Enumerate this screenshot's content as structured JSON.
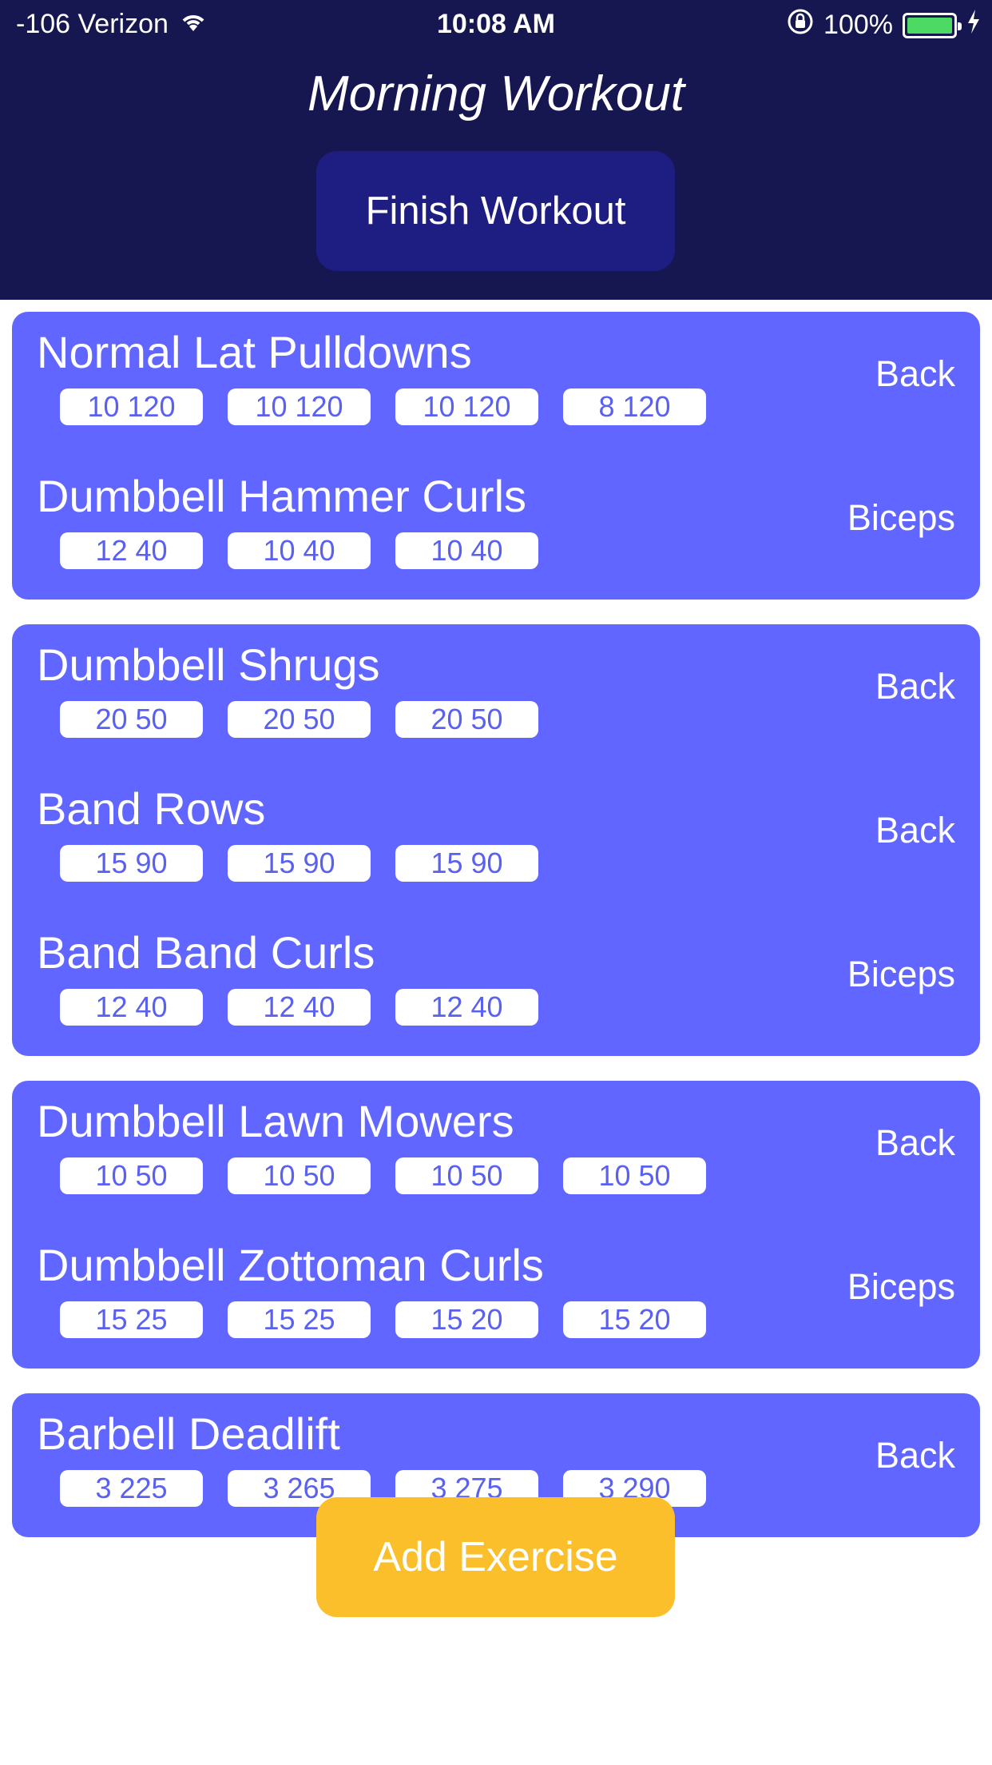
{
  "status_bar": {
    "carrier": "-106 Verizon",
    "time": "10:08 AM",
    "battery": "100%",
    "battery_level": 1.0
  },
  "header": {
    "title": "Morning Workout",
    "finish_label": "Finish Workout"
  },
  "groups": [
    {
      "exercises": [
        {
          "name": "Normal Lat Pulldowns",
          "muscle": "Back",
          "sets": [
            "10 120",
            "10 120",
            "10 120",
            "8 120"
          ]
        },
        {
          "name": "Dumbbell Hammer Curls",
          "muscle": "Biceps",
          "sets": [
            "12 40",
            "10 40",
            "10 40"
          ]
        }
      ]
    },
    {
      "exercises": [
        {
          "name": "Dumbbell Shrugs",
          "muscle": "Back",
          "sets": [
            "20 50",
            "20 50",
            "20 50"
          ]
        },
        {
          "name": "Band Rows",
          "muscle": "Back",
          "sets": [
            "15 90",
            "15 90",
            "15 90"
          ]
        },
        {
          "name": "Band Band Curls",
          "muscle": "Biceps",
          "sets": [
            "12 40",
            "12 40",
            "12 40"
          ]
        }
      ]
    },
    {
      "exercises": [
        {
          "name": "Dumbbell Lawn Mowers",
          "muscle": "Back",
          "sets": [
            "10 50",
            "10 50",
            "10 50",
            "10 50"
          ]
        },
        {
          "name": "Dumbbell Zottoman Curls",
          "muscle": "Biceps",
          "sets": [
            "15 25",
            "15 25",
            "15 20",
            "15 20"
          ]
        }
      ]
    },
    {
      "exercises": [
        {
          "name": "Barbell Deadlift",
          "muscle": "Back",
          "sets": [
            "3 225",
            "3 265",
            "3 275",
            "3 290"
          ]
        }
      ]
    }
  ],
  "add_exercise_label": "Add Exercise",
  "colors": {
    "header_bg": "#161651",
    "card_bg": "#6066ff",
    "accent_button": "#fbbf2c"
  }
}
